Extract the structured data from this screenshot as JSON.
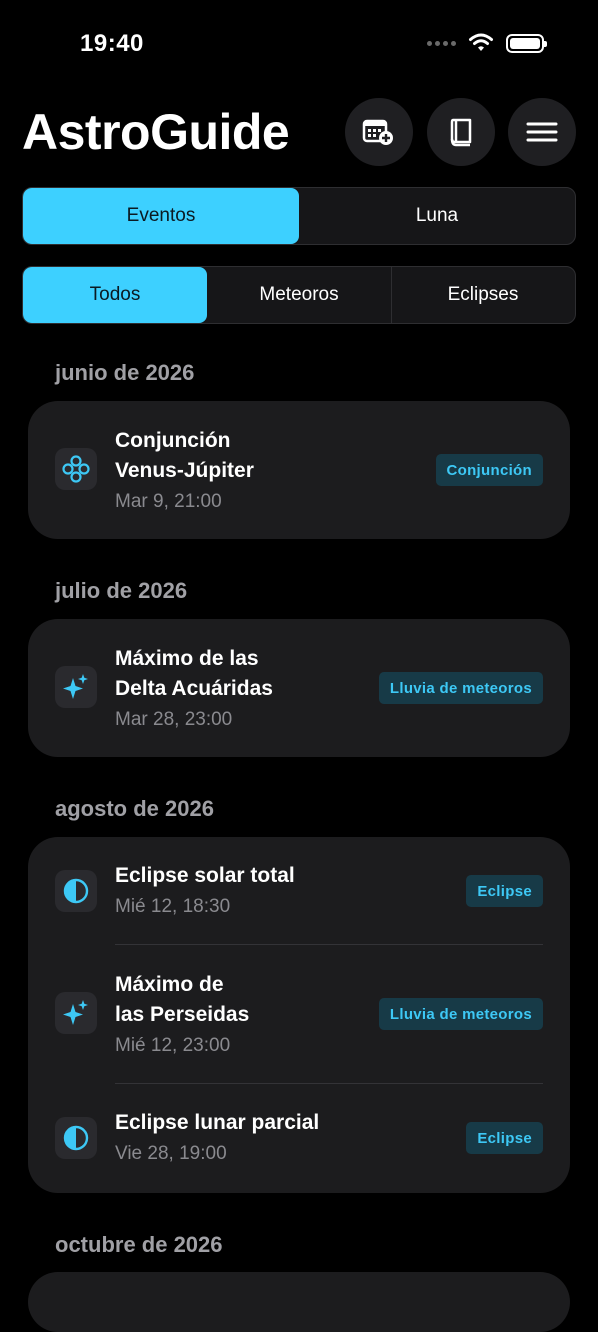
{
  "status": {
    "time": "19:40"
  },
  "header": {
    "title": "AstroGuide"
  },
  "main_tabs": [
    {
      "label": "Eventos"
    },
    {
      "label": "Luna"
    }
  ],
  "filter_tabs": [
    {
      "label": "Todos"
    },
    {
      "label": "Meteoros"
    },
    {
      "label": "Eclipses"
    }
  ],
  "sections": [
    {
      "month": "junio de 2026",
      "events": [
        {
          "title_line1": "Conjunción",
          "title_line2": "Venus-Júpiter",
          "date": "Mar 9, 21:00",
          "tag": "Conjunción",
          "icon": "conjunction-icon"
        }
      ]
    },
    {
      "month": "julio de 2026",
      "events": [
        {
          "title_line1": "Máximo de las",
          "title_line2": "Delta Acuáridas",
          "date": "Mar 28, 23:00",
          "tag": "Lluvia de meteoros",
          "icon": "sparkles-icon"
        }
      ]
    },
    {
      "month": "agosto de 2026",
      "events": [
        {
          "title": "Eclipse solar total",
          "date": "Mié 12, 18:30",
          "tag": "Eclipse",
          "icon": "eclipse-icon"
        },
        {
          "title_line1": "Máximo de",
          "title_line2": "las Perseidas",
          "date": "Mié 12, 23:00",
          "tag": "Lluvia de meteoros",
          "icon": "sparkles-icon"
        },
        {
          "title": "Eclipse lunar parcial",
          "date": "Vie 28, 19:00",
          "tag": "Eclipse",
          "icon": "eclipse-icon"
        }
      ]
    },
    {
      "month": "octubre de 2026",
      "events": []
    }
  ],
  "colors": {
    "accent": "#3dd0ff",
    "card": "#1c1c1e",
    "tag_bg": "#173a47",
    "tag_text": "#3dc8f5"
  }
}
